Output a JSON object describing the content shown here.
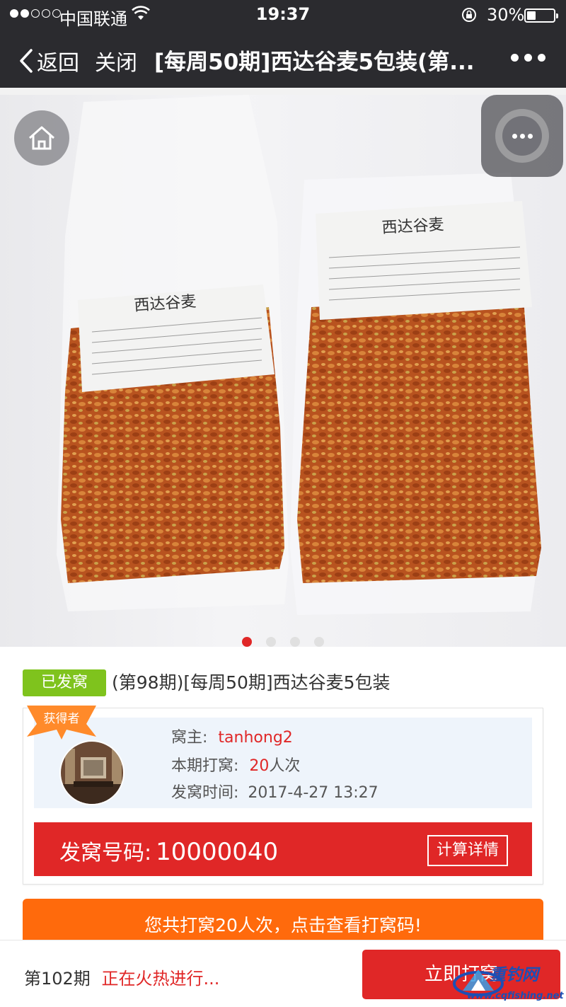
{
  "status_bar": {
    "carrier": "中国联通",
    "time": "19:37",
    "battery": "30%"
  },
  "nav": {
    "back_label": "返回",
    "close_label": "关闭",
    "title": "[每周50期]西达谷麦5包装(第..."
  },
  "hero": {
    "bag_label": "西达谷麦",
    "slides_total": 4,
    "active_slide": 1
  },
  "product": {
    "badge": "已发窝",
    "title": "(第98期)[每周50期]西达谷麦5包装"
  },
  "winner": {
    "ribbon": "获得者",
    "owner_label": "窝主:",
    "owner_value": "tanhong2",
    "count_label": "本期打窝:",
    "count_value": "20",
    "count_unit": "人次",
    "time_label": "发窝时间:",
    "time_value": "2017-4-27 13:27"
  },
  "code_bar": {
    "label": "发窝号码:",
    "value": "10000040",
    "button": "计算详情"
  },
  "cta": {
    "text": "您共打窝20人次，点击查看打窝码!"
  },
  "bottom": {
    "period": "第102期",
    "status": "正在火热进行...",
    "button": "立即打窝"
  },
  "watermark": {
    "name": "重钓网",
    "url": "www.cqfishing.net"
  },
  "colors": {
    "accent_red": "#e02727",
    "badge_green": "#7fc31d",
    "cta_orange": "#ff6a0c",
    "nav_dark": "#2b2b2f"
  }
}
